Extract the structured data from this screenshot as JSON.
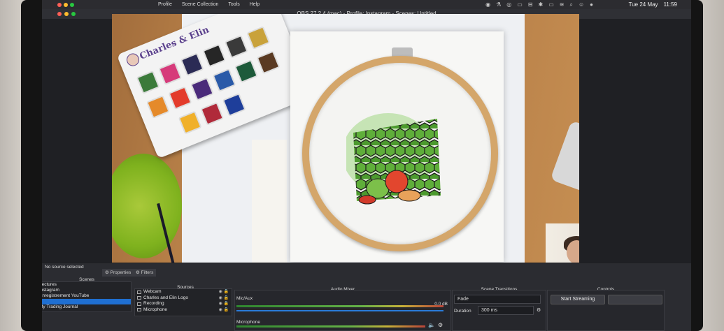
{
  "menubar": {
    "items": [
      "Profile",
      "Scene Collection",
      "Tools",
      "Help"
    ],
    "date": "Tue 24 May",
    "time": "11:59"
  },
  "window": {
    "title": "OBS 27.2.4 (mac) - Profile: Instagram - Scenes: Untitled"
  },
  "preview": {
    "palette_brand": "Charles & Elin"
  },
  "panel": {
    "no_source": "No source selected",
    "properties_tab": "Properties",
    "filters_tab": "Filters"
  },
  "scenes": {
    "title": "Scenes",
    "items": [
      {
        "label": "Lectures"
      },
      {
        "label": "Instagram"
      },
      {
        "label": "Enregistrement YouTube"
      },
      {
        "label": "",
        "selected": true
      },
      {
        "label": "My Trading Journal"
      }
    ]
  },
  "sources": {
    "title": "Sources",
    "items": [
      {
        "label": "Webcam"
      },
      {
        "label": "Charles and Elin Logo"
      },
      {
        "label": "Recording"
      },
      {
        "label": "Microphone"
      }
    ]
  },
  "mixer": {
    "title": "Audio Mixer",
    "channels": [
      {
        "name": "Mic/Aux",
        "db": "0.0 dB"
      },
      {
        "name": "Microphone",
        "db": ""
      }
    ]
  },
  "transitions": {
    "title": "Scene Transitions",
    "type": "Fade",
    "duration_label": "Duration",
    "duration_value": "300 ms"
  },
  "controls": {
    "title": "Controls",
    "start_streaming": "Start Streaming"
  },
  "colors": {
    "accent": "#1f6fd1",
    "panel_bg": "#2b2c31"
  }
}
